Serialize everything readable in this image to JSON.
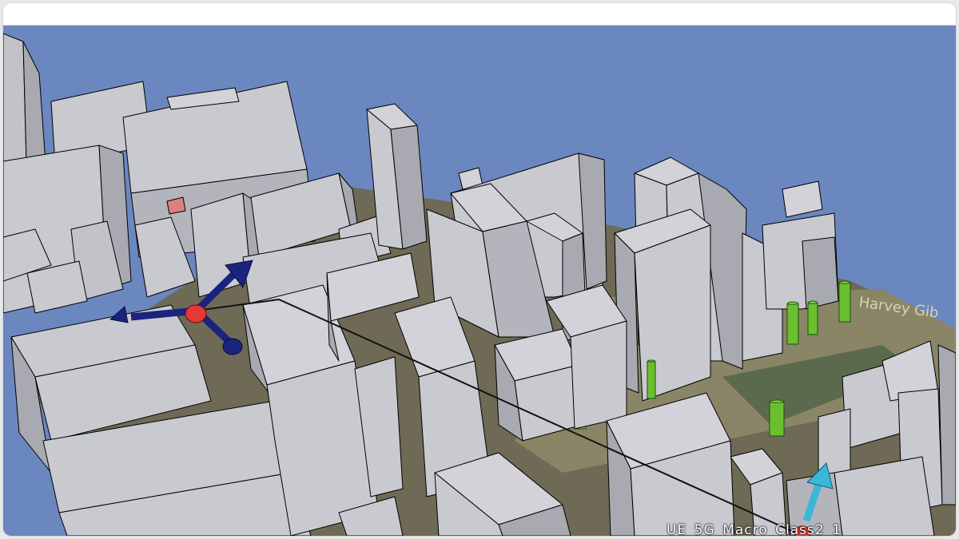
{
  "window": {
    "title": ""
  },
  "scene": {
    "sky_color": "#6b87bf",
    "building_color": "#c9c9d0",
    "ground_colors": [
      "#6e6a56",
      "#8a8566",
      "#5b6a4c"
    ],
    "transmitter_color": "#1a237e",
    "transmitter_center_color": "#e53935",
    "receiver_color": "#3bb6d8",
    "sensor_color": "#6abf2e",
    "link_line_color": "#111111",
    "overlay_label": "UE_5G_Macro_Class2_1",
    "ground_text": "Harvey Gib"
  }
}
